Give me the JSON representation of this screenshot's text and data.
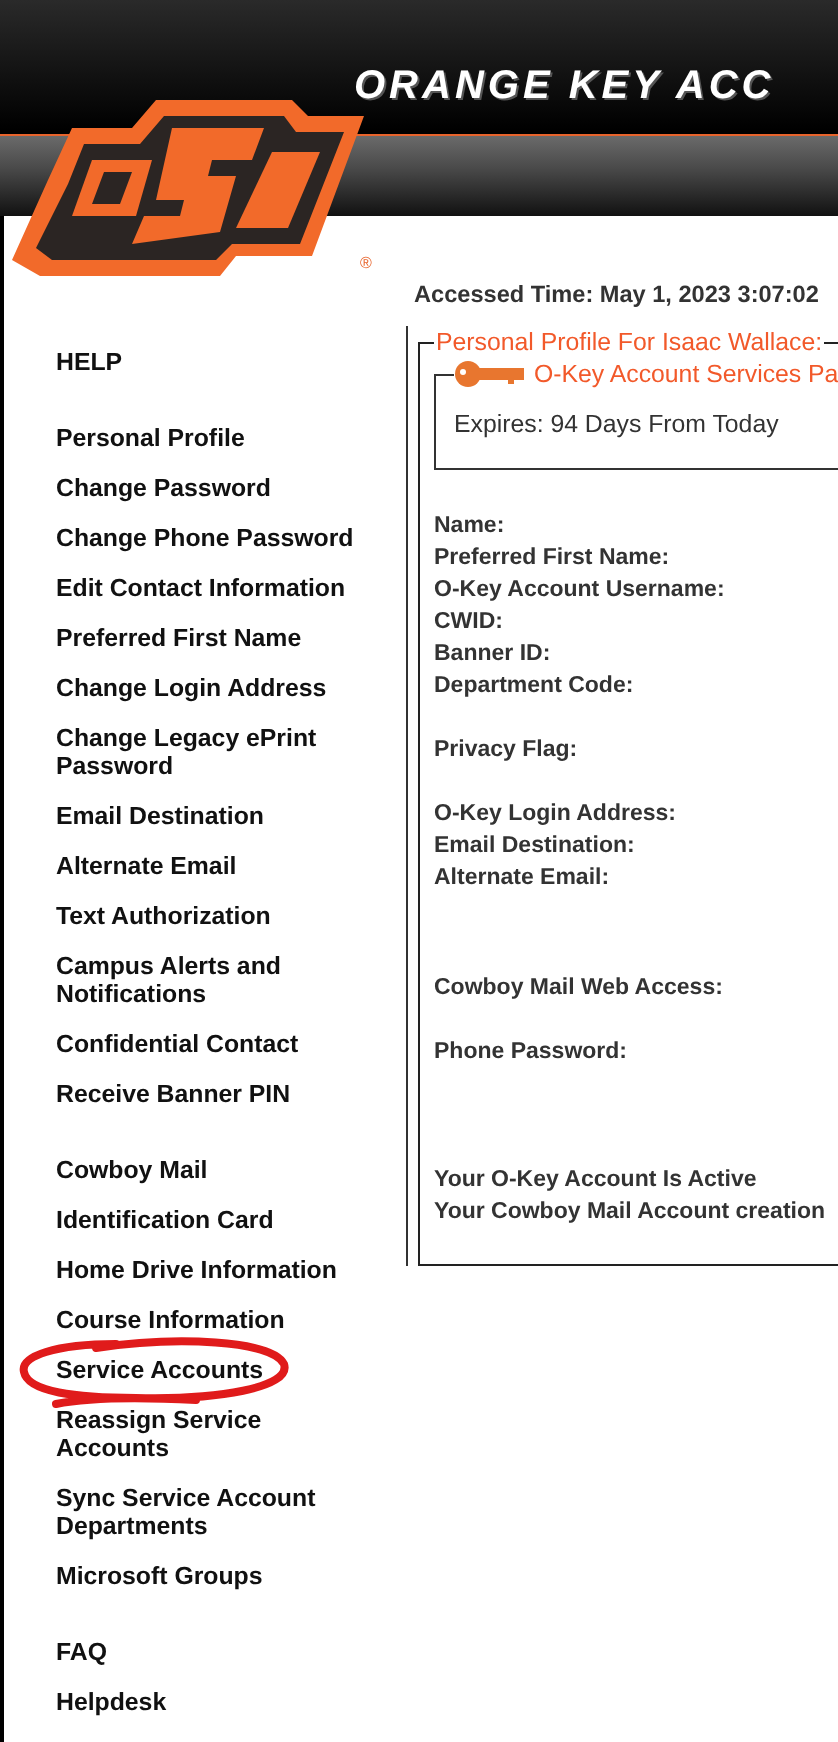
{
  "header": {
    "title": "ORANGE KEY ACC",
    "logo_mark": "®"
  },
  "sidebar": {
    "groups": [
      {
        "items": [
          {
            "label": "HELP",
            "circled": false
          }
        ]
      },
      {
        "items": [
          {
            "label": "Personal Profile",
            "circled": false
          },
          {
            "label": "Change Password",
            "circled": false
          },
          {
            "label": "Change Phone Password",
            "circled": false
          },
          {
            "label": "Edit Contact Information",
            "circled": false
          },
          {
            "label": "Preferred First Name",
            "circled": false
          },
          {
            "label": "Change Login Address",
            "circled": false
          },
          {
            "label": "Change Legacy ePrint Password",
            "circled": false
          },
          {
            "label": "Email Destination",
            "circled": false
          },
          {
            "label": "Alternate Email",
            "circled": false
          },
          {
            "label": "Text Authorization",
            "circled": false
          },
          {
            "label": "Campus Alerts and Notifications",
            "circled": false
          },
          {
            "label": "Confidential Contact",
            "circled": false
          },
          {
            "label": "Receive Banner PIN",
            "circled": false
          }
        ]
      },
      {
        "items": [
          {
            "label": "Cowboy Mail",
            "circled": false
          },
          {
            "label": "Identification Card",
            "circled": false
          },
          {
            "label": "Home Drive Information",
            "circled": false
          },
          {
            "label": "Course Information",
            "circled": false
          },
          {
            "label": "Service Accounts",
            "circled": true
          },
          {
            "label": "Reassign Service Accounts",
            "circled": false
          },
          {
            "label": "Sync Service Account Departments",
            "circled": false
          },
          {
            "label": "Microsoft Groups",
            "circled": false
          }
        ]
      },
      {
        "items": [
          {
            "label": "FAQ",
            "circled": false
          },
          {
            "label": "Helpdesk",
            "circled": false
          }
        ]
      }
    ]
  },
  "accessed_time": "Accessed Time: May 1, 2023 3:07:02",
  "profile": {
    "legend": "Personal Profile For Isaac Wallace:",
    "account_box": {
      "legend": "O-Key Account Services Pa",
      "expires": "Expires: 94 Days From Today"
    },
    "field_groups": [
      [
        "Name:",
        "Preferred First Name:",
        "O-Key Account Username:",
        "CWID:",
        "Banner ID:",
        "Department Code:"
      ],
      [
        "Privacy Flag:"
      ],
      [
        "O-Key Login Address:",
        "Email Destination:",
        "Alternate Email:"
      ],
      [
        "Cowboy Mail Web Access:"
      ],
      [
        "Phone Password:"
      ]
    ],
    "status": [
      "Your O-Key Account Is Active",
      "Your Cowboy Mail Account creation"
    ]
  }
}
